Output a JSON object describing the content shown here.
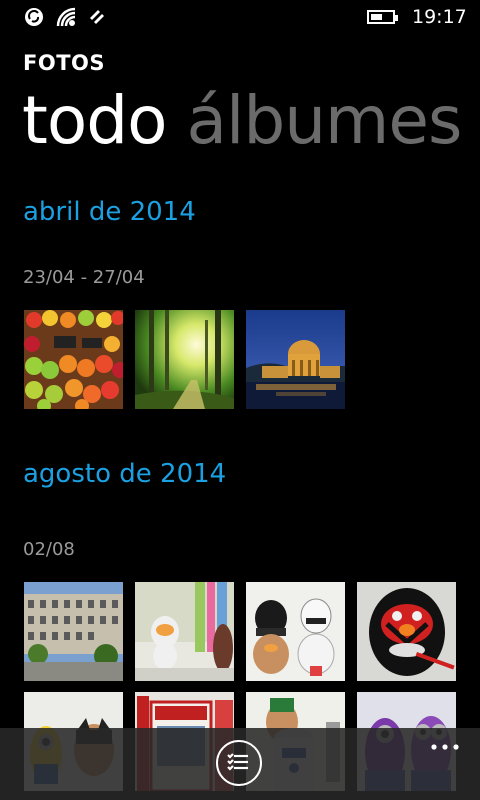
{
  "status": {
    "time": "19:17",
    "battery_level": 0.55,
    "icons": [
      "nfc-icon",
      "wifi-icon",
      "data-sync-icon"
    ]
  },
  "app": {
    "title": "FOTOS"
  },
  "pivot": {
    "items": [
      {
        "label": "todo",
        "active": true
      },
      {
        "label": "álbumes",
        "active": false
      }
    ]
  },
  "sections": [
    {
      "month": "abril de 2014",
      "range": "23/04 - 27/04",
      "photos": [
        "fruit-market",
        "forest-sunlight",
        "palace-night"
      ]
    },
    {
      "month": "agosto de 2014",
      "range": "02/08",
      "photos": [
        "building",
        "toy-figure",
        "darth-potato-stormtrooper",
        "darth-maul-potato",
        "minion-batman",
        "comic-books",
        "r2d2-potato",
        "purple-minions"
      ]
    }
  ],
  "appbar": {
    "button_icon": "select-list-icon",
    "more_icon": "more-dots-icon"
  },
  "colors": {
    "accent": "#1ba1e2",
    "inactive_pivot": "#6b6b6b",
    "background": "#000000"
  }
}
